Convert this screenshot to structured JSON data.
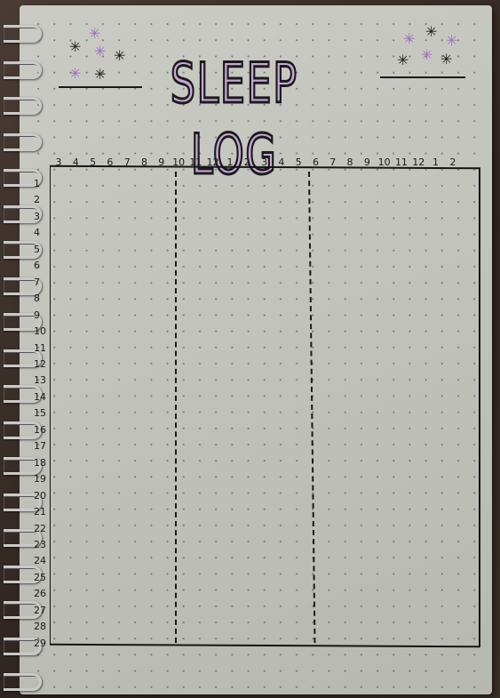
{
  "title": "SLEEP LOG",
  "hours": [
    "3",
    "4",
    "5",
    "6",
    "7",
    "8",
    "9",
    "10",
    "11",
    "12",
    "1",
    "2",
    "3",
    "4",
    "5",
    "6",
    "7",
    "8",
    "9",
    "10",
    "11",
    "12",
    "1",
    "2"
  ],
  "days": [
    "1",
    "2",
    "3",
    "4",
    "5",
    "6",
    "7",
    "8",
    "9",
    "10",
    "11",
    "12",
    "13",
    "14",
    "15",
    "16",
    "17",
    "18",
    "19",
    "20",
    "21",
    "22",
    "23",
    "24",
    "25",
    "26",
    "27",
    "28",
    "29"
  ],
  "colors": {
    "accent": "#c8a6d8",
    "ink": "#1b1b1b",
    "paper": "#c4c6be",
    "cover": "#1fa39c"
  }
}
